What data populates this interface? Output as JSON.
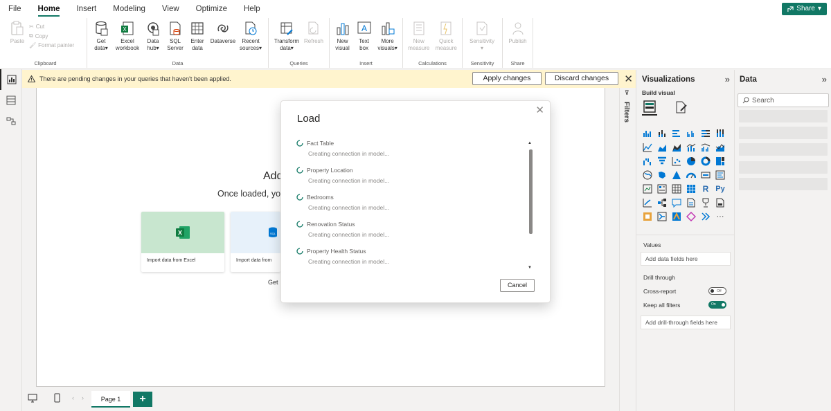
{
  "menu": {
    "items": [
      "File",
      "Home",
      "Insert",
      "Modeling",
      "View",
      "Optimize",
      "Help"
    ],
    "active": "Home",
    "share_label": "Share"
  },
  "ribbon": {
    "clipboard": {
      "paste": "Paste",
      "cut": "Cut",
      "copy": "Copy",
      "format_painter": "Format painter",
      "label": "Clipboard"
    },
    "data": {
      "buttons": [
        {
          "label": "Get data",
          "line1": "Get",
          "line2": "data"
        },
        {
          "label": "Excel workbook",
          "line1": "Excel",
          "line2": "workbook"
        },
        {
          "label": "Data hub",
          "line1": "Data",
          "line2": "hub"
        },
        {
          "label": "SQL Server",
          "line1": "SQL",
          "line2": "Server"
        },
        {
          "label": "Enter data",
          "line1": "Enter",
          "line2": "data"
        },
        {
          "label": "Dataverse",
          "line1": "Dataverse",
          "line2": ""
        },
        {
          "label": "Recent sources",
          "line1": "Recent",
          "line2": "sources"
        }
      ],
      "label": "Data"
    },
    "queries": {
      "transform": {
        "line1": "Transform",
        "line2": "data"
      },
      "refresh": "Refresh",
      "label": "Queries"
    },
    "insert": {
      "buttons": [
        {
          "line1": "New",
          "line2": "visual"
        },
        {
          "line1": "Text",
          "line2": "box"
        },
        {
          "line1": "More",
          "line2": "visuals"
        }
      ],
      "label": "Insert"
    },
    "calculations": {
      "buttons": [
        {
          "line1": "New",
          "line2": "measure"
        },
        {
          "line1": "Quick",
          "line2": "measure"
        }
      ],
      "label": "Calculations"
    },
    "sensitivity": {
      "button": "Sensitivity",
      "label": "Sensitivity"
    },
    "share": {
      "button": "Publish",
      "label": "Share"
    }
  },
  "notification": {
    "text": "There are pending changes in your queries that haven't been applied.",
    "apply": "Apply changes",
    "discard": "Discard changes"
  },
  "canvas": {
    "title": "Add",
    "subtitle": "Once loaded, yo",
    "card_excel": "Import data from Excel",
    "card_sql": "Import data from",
    "get_link": "Get"
  },
  "filters": {
    "label": "Filters"
  },
  "pages": {
    "tab": "Page 1",
    "add": "+"
  },
  "visualizations": {
    "title": "Visualizations",
    "build_label": "Build visual",
    "values_label": "Values",
    "values_placeholder": "Add data fields here",
    "drill_label": "Drill through",
    "cross_report": "Cross-report",
    "cross_report_state": "Off",
    "keep_filters": "Keep all filters",
    "keep_filters_state": "On",
    "drill_placeholder": "Add drill-through fields here"
  },
  "data_pane": {
    "title": "Data",
    "search_placeholder": "Search"
  },
  "dialog": {
    "title": "Load",
    "items": [
      {
        "name": "Fact Table",
        "status": "Creating connection in model..."
      },
      {
        "name": "Property Location",
        "status": "Creating connection in model..."
      },
      {
        "name": "Bedrooms",
        "status": "Creating connection in model..."
      },
      {
        "name": "Renovation Status",
        "status": "Creating connection in model..."
      },
      {
        "name": "Property Health Status",
        "status": "Creating connection in model..."
      }
    ],
    "cancel": "Cancel"
  },
  "colors": {
    "accent": "#117865",
    "warning_bg": "#fff4ce",
    "excel": "#107c41",
    "sql": "#0078d4"
  }
}
